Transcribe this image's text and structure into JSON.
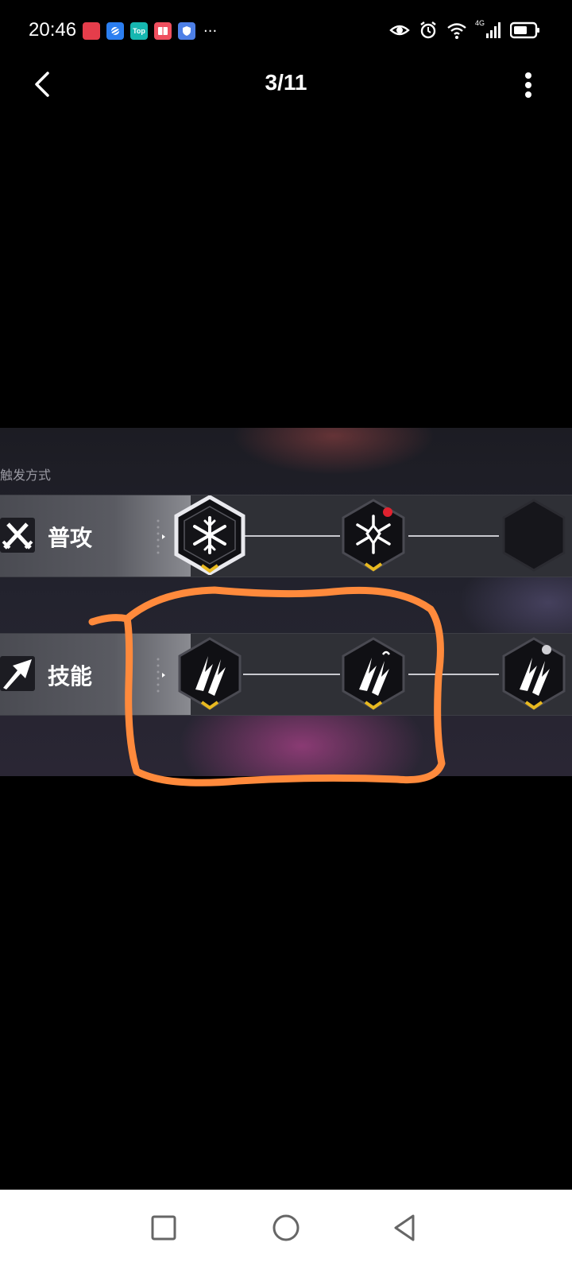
{
  "status_bar": {
    "time": "20:46",
    "apps": [
      {
        "icon": "red-app-icon",
        "label": "",
        "color": "#e53d4b"
      },
      {
        "icon": "blue-planet-app-icon",
        "label": "",
        "color": "#2b7ef0"
      },
      {
        "icon": "top-app-icon",
        "label": "Top",
        "color": "#16b7b0"
      },
      {
        "icon": "book-app-icon",
        "label": "",
        "color": "#ef4f5f"
      },
      {
        "icon": "shield-app-icon",
        "label": "",
        "color": "#4d7fe6"
      }
    ],
    "more": "···",
    "network_label": "4G"
  },
  "nav": {
    "page_counter": "3/11"
  },
  "image": {
    "section_label": "触发方式",
    "rows": [
      {
        "label": "普攻",
        "icon": "crossed-swords-icon"
      },
      {
        "label": "技能",
        "icon": "skill-arrow-icon"
      }
    ]
  },
  "colors": {
    "annotation": "#ff8a3c",
    "chevron": "#e8b920",
    "red_dot": "#e0222f"
  }
}
